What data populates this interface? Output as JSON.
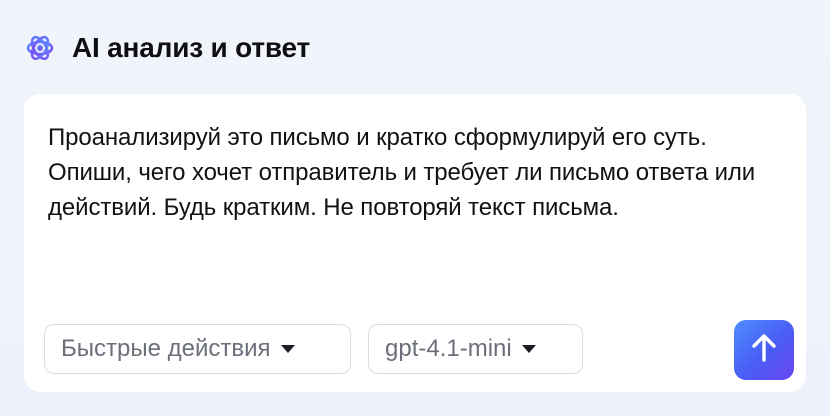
{
  "header": {
    "icon": "ai-sparkle-icon",
    "title": "AI анализ и ответ"
  },
  "prompt": {
    "text": "Проанализируй это письмо и кратко сформулируй его суть. Опиши, чего хочет отправитель и требует ли письмо ответа или действий. Будь кратким. Не повторяй текст письма."
  },
  "controls": {
    "quick_actions_label": "Быстрые действия",
    "model_label": "gpt-4.1-mini",
    "send_icon": "arrow-up-icon"
  },
  "colors": {
    "accent_start": "#4f8dff",
    "accent_end": "#6b46f3",
    "background": "#f2f4fb",
    "card": "#ffffff"
  }
}
